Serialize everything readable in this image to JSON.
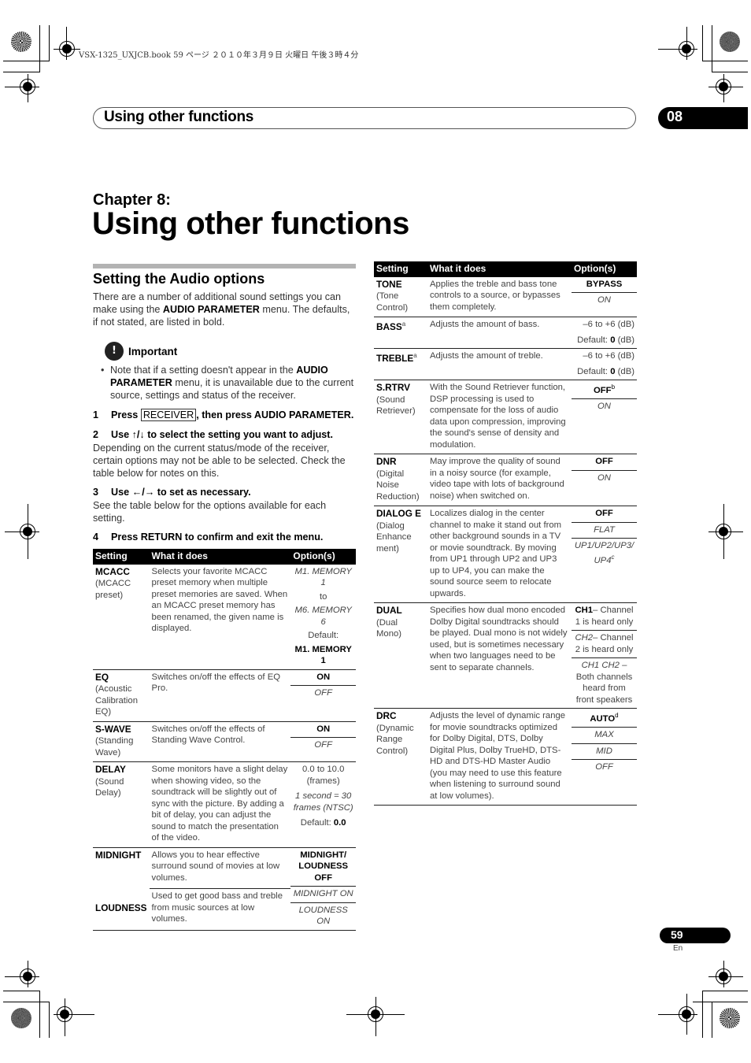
{
  "print_info": "VSX-1325_UXJCB.book  59 ページ  ２０１０年３月９日  火曜日  午後３時４分",
  "running_header": {
    "title": "Using other functions",
    "chapter_number": "08"
  },
  "chapter": {
    "label": "Chapter 8:",
    "title": "Using other functions"
  },
  "section": {
    "title": "Setting the Audio options",
    "intro_pre": "There are a number of additional sound settings you can make using the ",
    "intro_bold": "AUDIO PARAMETER",
    "intro_post": " menu. The defaults, if not stated, are listed in bold.",
    "important": {
      "label": "Important",
      "note_pre": "Note that if a setting doesn't appear in the ",
      "note_bold": "AUDIO PARAMETER",
      "note_post": " menu, it is unavailable due to the current source, settings and status of the receiver."
    },
    "steps": [
      {
        "num": "1",
        "pre": "Press ",
        "key": "RECEIVER",
        "post": ", then press AUDIO PARAMETER."
      },
      {
        "num": "2",
        "text": "Use ↑/↓ to select the setting you want to adjust.",
        "detail": "Depending on the current status/mode of the receiver, certain options may not be able to be selected. Check the table below for notes on this."
      },
      {
        "num": "3",
        "text": "Use ←/→ to set as necessary.",
        "detail": "See the table below for the options available for each setting."
      },
      {
        "num": "4",
        "text": "Press RETURN to confirm and exit the menu."
      }
    ]
  },
  "table_headers": {
    "setting": "Setting",
    "what": "What it does",
    "options": "Option(s)"
  },
  "table_left": [
    {
      "name": "MCACC",
      "sub": "(MCACC preset)",
      "desc": "Selects your favorite MCACC preset memory when multiple preset memories are saved. When an MCACC preset memory has been renamed, the given name is displayed.",
      "opt1": "M1. MEMORY 1",
      "opt2": "to",
      "opt3": "M6. MEMORY 6",
      "opt4": "Default:",
      "opt5": "M1. MEMORY 1"
    },
    {
      "name": "EQ",
      "sub": "(Acoustic Calibration EQ)",
      "desc": "Switches on/off the effects of EQ Pro.",
      "opt1": "ON",
      "opt2": "OFF"
    },
    {
      "name": "S-WAVE",
      "sub": "(Standing Wave)",
      "desc": "Switches on/off the effects of Standing Wave Control.",
      "opt1": "ON",
      "opt2": "OFF"
    },
    {
      "name": "DELAY",
      "sub": "(Sound Delay)",
      "desc": "Some monitors have a slight delay when showing video, so the soundtrack will be slightly out of sync with the picture. By adding a bit of delay, you can adjust the sound to match the presentation of the video.",
      "opt1": "0.0 to 10.0 (frames)",
      "opt2": "1 second = 30 frames (NTSC)",
      "opt3": "Default: ",
      "opt4": "0.0"
    },
    {
      "name": "MIDNIGHT",
      "desc": "Allows you to hear effective surround sound of movies at low volumes.",
      "opt1": "MIDNIGHT/ LOUDNESS OFF",
      "opt2": "MIDNIGHT ON",
      "opt3": "LOUDNESS ON"
    },
    {
      "name": "LOUDNESS",
      "desc": "Used to get good bass and treble from music sources at low volumes."
    }
  ],
  "table_right": [
    {
      "name": "TONE",
      "sub": "(Tone Control)",
      "desc": "Applies the treble and bass tone controls to a source, or bypasses them completely.",
      "opt1": "BYPASS",
      "opt2": "ON"
    },
    {
      "name": "BASS",
      "note": "a",
      "desc": "Adjusts the amount of bass.",
      "opt1": "–6 to +6 (dB)",
      "opt2": "Default: ",
      "opt3": "0",
      "opt4": " (dB)"
    },
    {
      "name": "TREBLE",
      "note": "a",
      "desc": "Adjusts the amount of treble.",
      "opt1": "–6 to +6 (dB)",
      "opt2": "Default: ",
      "opt3": "0",
      "opt4": " (dB)"
    },
    {
      "name": "S.RTRV",
      "sub": "(Sound Retriever)",
      "desc": "With the Sound Retriever function, DSP processing is used to compensate for the loss of audio data upon compression, improving the sound's sense of density and modulation.",
      "opt1": "OFF",
      "opt1_note": "b",
      "opt2": "ON"
    },
    {
      "name": "DNR",
      "sub": "(Digital Noise Reduction)",
      "desc": "May improve the quality of sound in a noisy source (for example, video tape with lots of background noise) when switched on.",
      "opt1": "OFF",
      "opt2": "ON"
    },
    {
      "name": "DIALOG E",
      "sub": "(Dialog Enhance ment)",
      "desc": "Localizes dialog in the center channel to make it stand out from other background sounds in a TV or movie soundtrack. By moving from UP1 through UP2 and UP3 up to UP4, you can make the sound source seem to relocate upwards.",
      "opt1": "OFF",
      "opt2": "FLAT",
      "opt3": "UP1/UP2/UP3/ UP4",
      "opt3_note": "c"
    },
    {
      "name": "DUAL",
      "sub": "(Dual Mono)",
      "desc": "Specifies how dual mono encoded Dolby Digital soundtracks should be played. Dual mono is not widely used, but is sometimes necessary when two languages need to be sent to separate channels.",
      "opt1a": "CH1",
      "opt1b": "– Channel 1 is heard only",
      "opt2a": "CH2",
      "opt2b": "– Channel 2 is heard only",
      "opt3a": "CH1 CH2 –",
      "opt3b": "Both channels heard from front speakers"
    },
    {
      "name": "DRC",
      "sub": "(Dynamic Range Control)",
      "desc": "Adjusts the level of dynamic range for movie soundtracks optimized for Dolby Digital, DTS, Dolby Digital Plus, Dolby TrueHD, DTS-HD and DTS-HD Master Audio (you may need to use this feature when listening to surround sound at low volumes).",
      "opt1": "AUTO",
      "opt1_note": "d",
      "opt2": "MAX",
      "opt3": "MID",
      "opt4": "OFF"
    }
  ],
  "footer": {
    "page": "59",
    "lang": "En"
  }
}
